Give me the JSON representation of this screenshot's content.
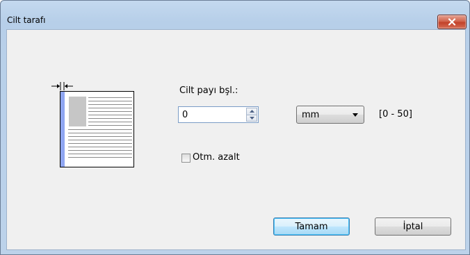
{
  "window": {
    "title": "Cilt tarafı"
  },
  "icons": {
    "close": "close-icon",
    "margin_width": "margin-width-icon",
    "document_preview": "page-binding-preview-icon"
  },
  "form": {
    "binding_label": "Cilt payı bşl.:",
    "binding_value": "0",
    "unit_selected": "mm",
    "range_text": "[0 - 50]",
    "auto_reduce_label": "Otm. azalt",
    "auto_reduce_checked": false
  },
  "buttons": {
    "ok_label": "Tamam",
    "cancel_label": "İptal"
  },
  "colors": {
    "accent_blue": "#8fa6f2",
    "close_red": "#c2412a"
  }
}
